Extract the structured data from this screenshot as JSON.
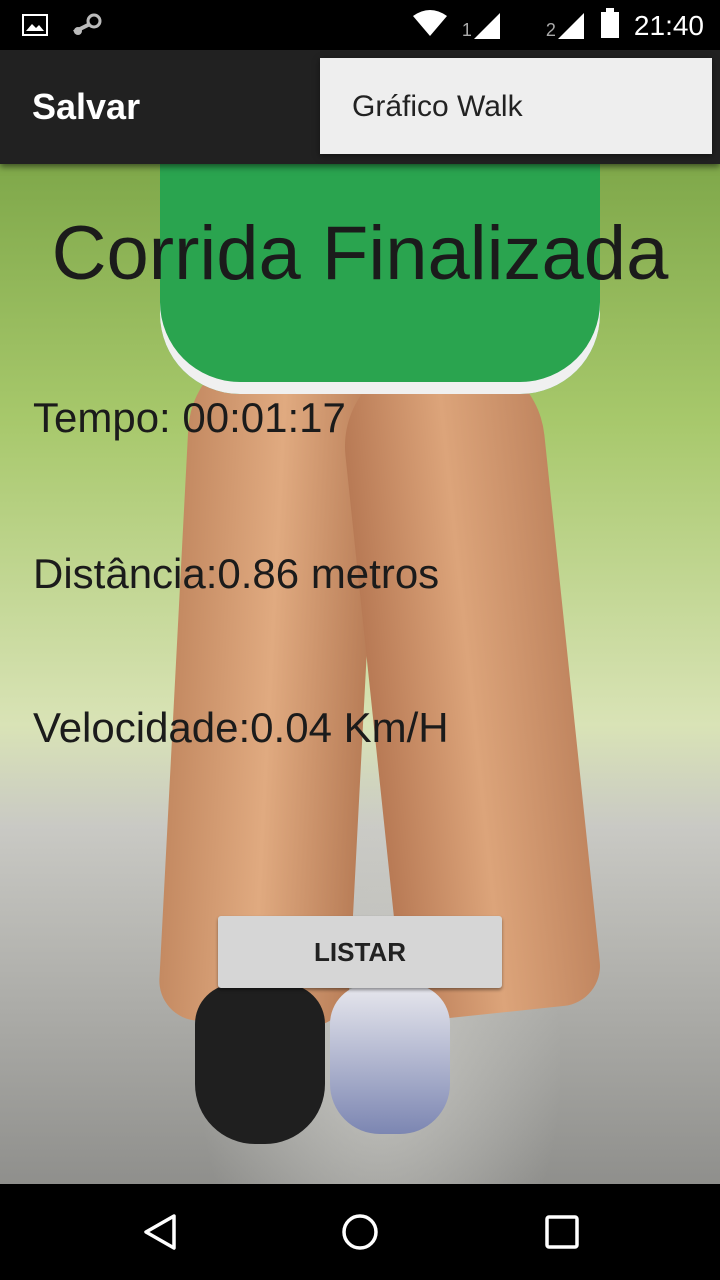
{
  "status_bar": {
    "time": "21:40",
    "sim1": "1",
    "sim2": "2",
    "icons": [
      "image-icon",
      "steam-icon",
      "wifi-icon",
      "signal-icon",
      "signal-icon",
      "battery-icon"
    ]
  },
  "action_bar": {
    "title": "Salvar"
  },
  "overflow_menu": {
    "items": [
      "Gráfico Walk"
    ]
  },
  "main": {
    "heading": "Corrida Finalizada",
    "tempo": "Tempo: 00:01:17",
    "distancia": "Distância:0.86 metros",
    "velocidade": "Velocidade:0.04 Km/H",
    "button_label": "LISTAR"
  },
  "nav_bar": {
    "icons": [
      "back-icon",
      "home-icon",
      "recents-icon"
    ]
  }
}
